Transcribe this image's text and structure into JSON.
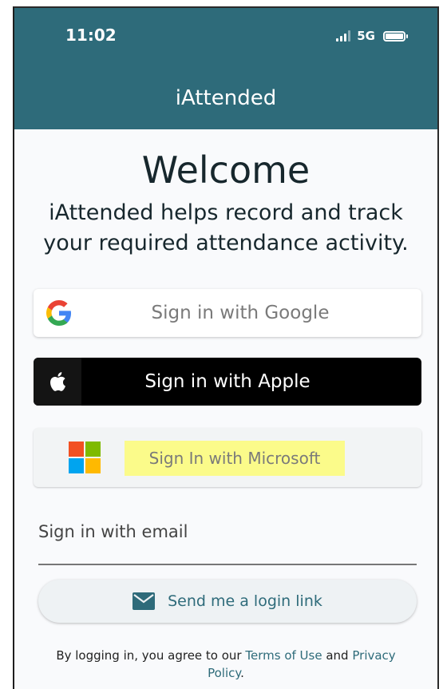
{
  "status_bar": {
    "time": "11:02",
    "network": "5G"
  },
  "header": {
    "title": "iAttended"
  },
  "main": {
    "welcome": "Welcome",
    "tagline": "iAttended helps record and track your required attendance activity."
  },
  "sign_in": {
    "google_label": "Sign in with Google",
    "apple_label": "Sign in with Apple",
    "microsoft_label": "Sign In with Microsoft"
  },
  "email": {
    "label": "Sign in with email",
    "send_link_label": "Send me a login link"
  },
  "footer": {
    "prefix": "By logging in, you agree to our",
    "terms_link": "Terms of Use",
    "and": "and",
    "privacy_link": "Privacy Policy",
    "suffix": "."
  },
  "colors": {
    "header_bg": "#2e6b7a",
    "accent": "#2e6b7a",
    "highlight": "#fbfb8a"
  }
}
